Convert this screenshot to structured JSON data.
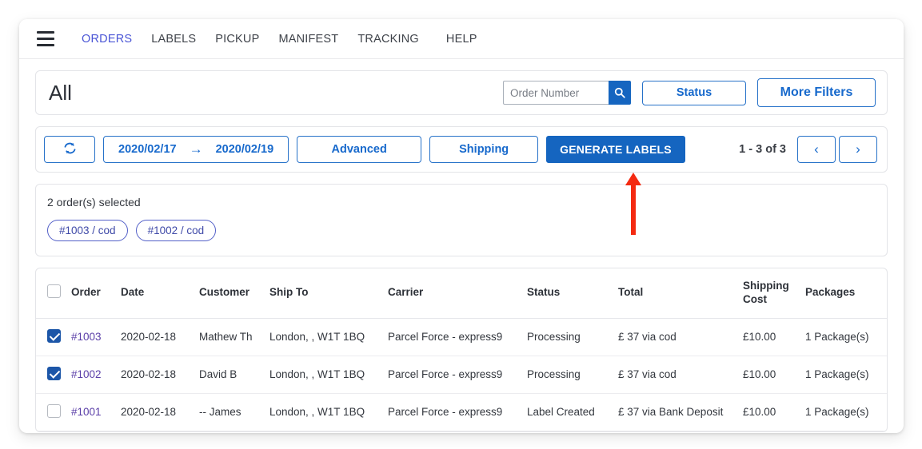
{
  "nav": {
    "menu_icon": "hamburger-menu-icon",
    "items": [
      {
        "label": "ORDERS",
        "active": true
      },
      {
        "label": "LABELS",
        "active": false
      },
      {
        "label": "PICKUP",
        "active": false
      },
      {
        "label": "MANIFEST",
        "active": false
      },
      {
        "label": "TRACKING",
        "active": false
      },
      {
        "label": "HELP",
        "active": false
      }
    ]
  },
  "header": {
    "title": "All",
    "search": {
      "placeholder": "Order Number",
      "value": "",
      "icon": "search-icon"
    },
    "status_button": "Status",
    "more_filters_button": "More Filters"
  },
  "toolbar": {
    "refresh_icon": "refresh-icon",
    "date_from": "2020/02/17",
    "date_arrow": "→",
    "date_to": "2020/02/19",
    "advanced_button": "Advanced",
    "shipping_button": "Shipping",
    "generate_button": "GENERATE LABELS",
    "page_info": "1 - 3 of 3",
    "prev_icon": "‹",
    "next_icon": "›"
  },
  "selection": {
    "summary": "2 order(s) selected",
    "chips": [
      "#1003 / cod",
      "#1002 / cod"
    ]
  },
  "table": {
    "columns": [
      "Order",
      "Date",
      "Customer",
      "Ship To",
      "Carrier",
      "Status",
      "Total",
      "Shipping Cost",
      "Packages"
    ],
    "select_all_checked": false,
    "rows": [
      {
        "checked": true,
        "order": "#1003",
        "date": "2020-02-18",
        "customer": "Mathew Th",
        "ship_to": "London, , W1T 1BQ",
        "carrier": "Parcel Force - express9",
        "status": "Processing",
        "total": "£ 37 via cod",
        "shipping_cost": "£10.00",
        "packages": "1 Package(s)"
      },
      {
        "checked": true,
        "order": "#1002",
        "date": "2020-02-18",
        "customer": "David B",
        "ship_to": "London, , W1T 1BQ",
        "carrier": "Parcel Force - express9",
        "status": "Processing",
        "total": "£ 37 via cod",
        "shipping_cost": "£10.00",
        "packages": "1 Package(s)"
      },
      {
        "checked": false,
        "order": "#1001",
        "date": "2020-02-18",
        "customer": "-- James",
        "ship_to": "London, , W1T 1BQ",
        "carrier": "Parcel Force - express9",
        "status": "Label Created",
        "total": "£ 37 via Bank Deposit",
        "shipping_cost": "£10.00",
        "packages": "1 Package(s)"
      }
    ]
  },
  "annotation": {
    "arrow": "up-arrow-annotation",
    "color": "#f42a11",
    "points_at": "GENERATE LABELS"
  },
  "colors": {
    "primary_blue": "#1565c0",
    "link_blue": "#1769cc",
    "nav_active": "#4a55d6",
    "chip_purple": "#3f4aa8",
    "order_link": "#5b3fa8",
    "annotation_red": "#f42a11"
  }
}
